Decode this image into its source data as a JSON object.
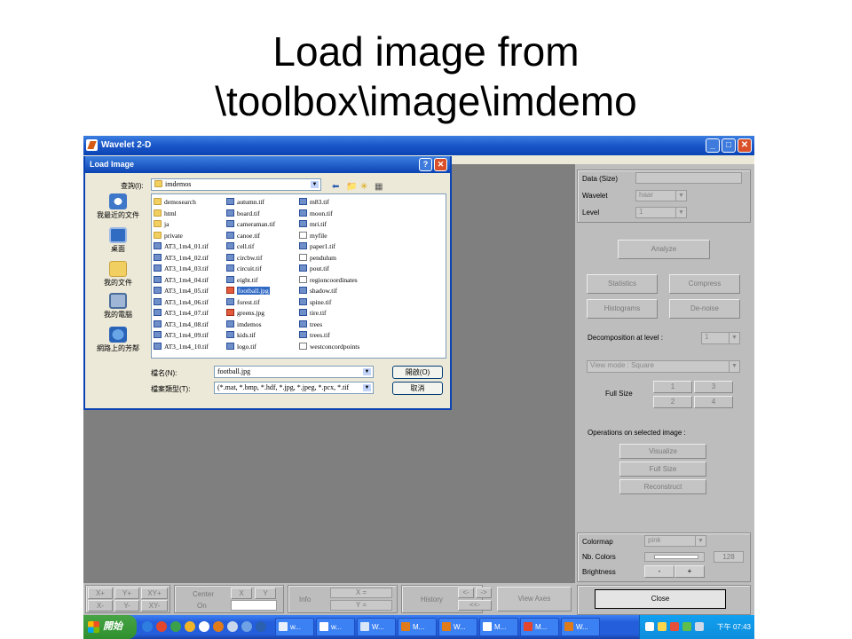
{
  "slide_title": {
    "line1": "Load image from",
    "line2": "\\toolbox\\image\\imdemo"
  },
  "window": {
    "title": "Wavelet 2-D",
    "controls": [
      "_",
      "□",
      "✕"
    ]
  },
  "panel": {
    "data_size_label": "Data  (Size)",
    "wavelet_label": "Wavelet",
    "wavelet_value": "haar",
    "level_label": "Level",
    "level_value": "1",
    "analyze": "Analyze",
    "statistics": "Statistics",
    "compress": "Compress",
    "histograms": "Histograms",
    "denoise": "De-noise",
    "decomp_label": "Decomposition at level :",
    "decomp_value": "1",
    "view_mode": "View mode : Square",
    "full_size_label": "Full Size",
    "fs_btns": [
      "1",
      "3",
      "2",
      "4"
    ],
    "ops_label": "Operations on selected image :",
    "visualize": "Visualize",
    "full_size_btn": "Full Size",
    "reconstruct": "Reconstruct",
    "colormap_label": "Colormap",
    "colormap_value": "pink",
    "nb_colors_label": "Nb. Colors",
    "nb_colors_value": "128",
    "brightness_label": "Brightness",
    "minus": "-",
    "plus": "+",
    "close": "Close"
  },
  "bottom": {
    "xplus": "X+",
    "yplus": "Y+",
    "xyplus": "XY+",
    "xminus": "X-",
    "yminus": "Y-",
    "xyminus": "XY-",
    "center": "Center",
    "on": "On",
    "x": "X",
    "y": "Y",
    "info": "Info",
    "xeq": "X =",
    "yeq": "Y =",
    "history": "History",
    "hist_back": "<-",
    "hist_fwd": "->",
    "hist_first": "<<-",
    "view_axes": "View Axes"
  },
  "dialog": {
    "title": "Load Image",
    "lookin_label": "查詢(I):",
    "lookin_value": "imdemos",
    "places": [
      "我最近的文件",
      "桌面",
      "我的文件",
      "我的電腦",
      "網路上的芳鄰"
    ],
    "filename_label": "檔名(N):",
    "filename_value": "football.jpg",
    "filetype_label": "檔案類型(T):",
    "filetype_value": "(*.mat, *.bmp, *.hdf, *.jpg, *.jpeg, *.pcx, *.tif",
    "open_btn": "開啟(O)",
    "cancel_btn": "取消",
    "files": {
      "col1": [
        {
          "name": "demosearch",
          "icon": "folder"
        },
        {
          "name": "html",
          "icon": "folder"
        },
        {
          "name": "ja",
          "icon": "folder"
        },
        {
          "name": "private",
          "icon": "folder"
        },
        {
          "name": "AT3_1m4_01.tif",
          "icon": "fig"
        },
        {
          "name": "AT3_1m4_02.tif",
          "icon": "fig"
        },
        {
          "name": "AT3_1m4_03.tif",
          "icon": "fig"
        },
        {
          "name": "AT3_1m4_04.tif",
          "icon": "fig"
        },
        {
          "name": "AT3_1m4_05.tif",
          "icon": "fig"
        },
        {
          "name": "AT3_1m4_06.tif",
          "icon": "fig"
        },
        {
          "name": "AT3_1m4_07.tif",
          "icon": "fig"
        },
        {
          "name": "AT3_1m4_08.tif",
          "icon": "fig"
        },
        {
          "name": "AT3_1m4_09.tif",
          "icon": "fig"
        },
        {
          "name": "AT3_1m4_10.tif",
          "icon": "fig"
        }
      ],
      "col2": [
        {
          "name": "autumn.tif",
          "icon": "fig"
        },
        {
          "name": "board.tif",
          "icon": "fig"
        },
        {
          "name": "cameraman.tif",
          "icon": "fig"
        },
        {
          "name": "canoe.tif",
          "icon": "fig"
        },
        {
          "name": "cell.tif",
          "icon": "fig"
        },
        {
          "name": "circbw.tif",
          "icon": "fig"
        },
        {
          "name": "circuit.tif",
          "icon": "fig"
        },
        {
          "name": "eight.tif",
          "icon": "fig"
        },
        {
          "name": "football.jpg",
          "icon": "jpg",
          "selected": true
        },
        {
          "name": "forest.tif",
          "icon": "fig"
        },
        {
          "name": "greens.jpg",
          "icon": "jpg"
        },
        {
          "name": "imdemos",
          "icon": "fig"
        },
        {
          "name": "kids.tif",
          "icon": "fig"
        },
        {
          "name": "logo.tif",
          "icon": "fig"
        }
      ],
      "col3": [
        {
          "name": "m83.tif",
          "icon": "fig"
        },
        {
          "name": "moon.tif",
          "icon": "fig"
        },
        {
          "name": "mri.tif",
          "icon": "fig"
        },
        {
          "name": "myfile",
          "icon": "blank"
        },
        {
          "name": "paper1.tif",
          "icon": "fig"
        },
        {
          "name": "pendulum",
          "icon": "blank"
        },
        {
          "name": "pout.tif",
          "icon": "fig"
        },
        {
          "name": "regioncoordinates",
          "icon": "blank"
        },
        {
          "name": "shadow.tif",
          "icon": "fig"
        },
        {
          "name": "spine.tif",
          "icon": "fig"
        },
        {
          "name": "tire.tif",
          "icon": "fig"
        },
        {
          "name": "trees",
          "icon": "fig"
        },
        {
          "name": "trees.tif",
          "icon": "fig"
        },
        {
          "name": "westconcordpoints",
          "icon": "blank"
        }
      ]
    }
  },
  "taskbar": {
    "start": "開始",
    "tasks": [
      "w...",
      "w...",
      "W...",
      "M...",
      "W...",
      "M...",
      "M...",
      "W..."
    ],
    "clock": "下午 07:43"
  }
}
